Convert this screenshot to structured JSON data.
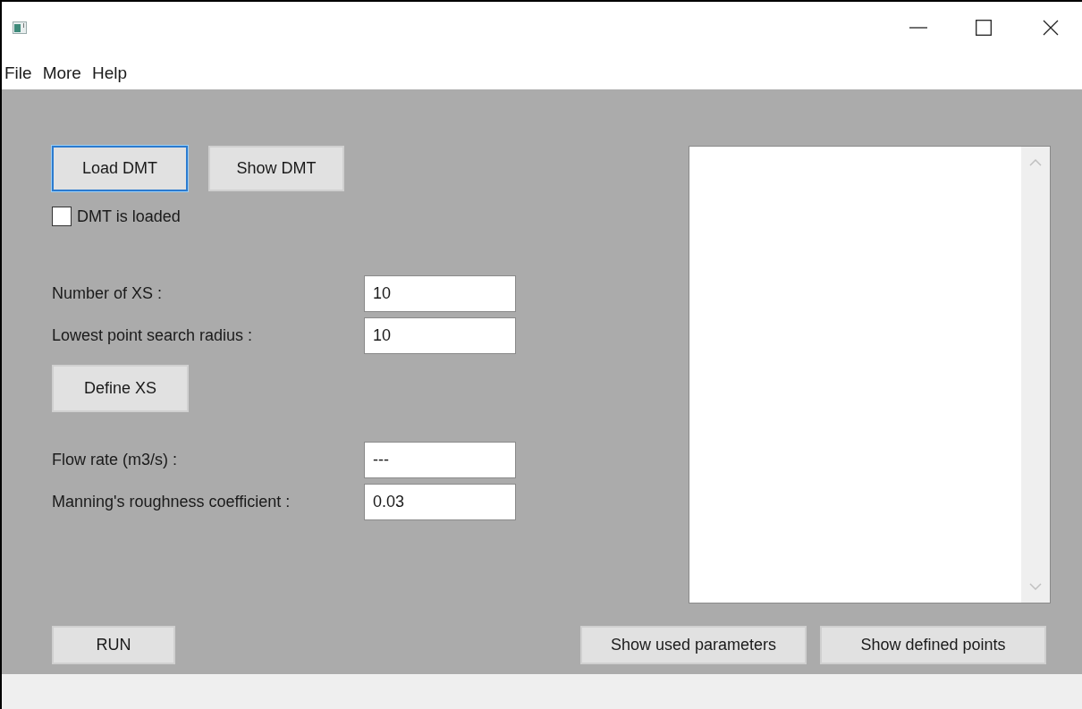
{
  "menu": [
    "File",
    "More",
    "Help"
  ],
  "dmt_buttons": [
    {
      "label": "Load DMT",
      "focused": true
    },
    {
      "label": "Show DMT",
      "focused": false
    }
  ],
  "dmt_checkbox": {
    "label": "DMT is loaded",
    "checked": false
  },
  "xs_fields": [
    {
      "label": "Number of XS :",
      "value": "10"
    },
    {
      "label": "Lowest point search radius :",
      "value": "10"
    }
  ],
  "define_button": "Define XS",
  "flow_fields": [
    {
      "label": "Flow rate (m3/s) :",
      "value": "---"
    },
    {
      "label": "Manning's roughness coefficient :",
      "value": "0.03"
    }
  ],
  "run_button": "RUN",
  "bottom_buttons": [
    "Show used parameters",
    "Show defined points"
  ]
}
